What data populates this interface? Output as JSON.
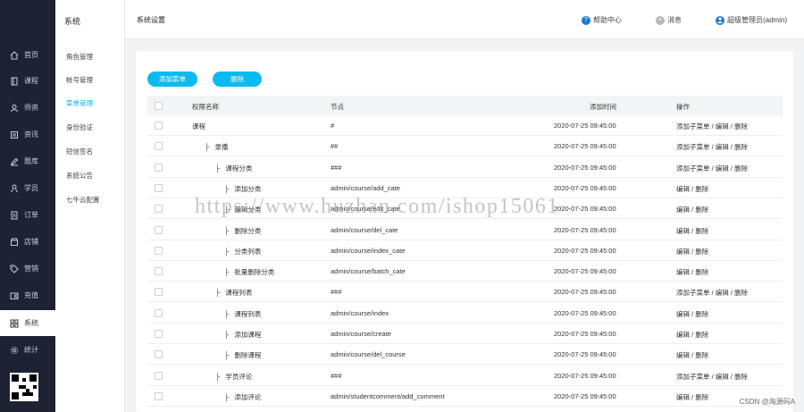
{
  "sidebar": {
    "items": [
      {
        "label": "首页",
        "icon": "home-icon"
      },
      {
        "label": "课程",
        "icon": "book-icon"
      },
      {
        "label": "师资",
        "icon": "teacher-icon"
      },
      {
        "label": "资讯",
        "icon": "news-icon"
      },
      {
        "label": "题库",
        "icon": "edit-icon"
      },
      {
        "label": "学员",
        "icon": "user-icon"
      },
      {
        "label": "订单",
        "icon": "order-icon"
      },
      {
        "label": "店铺",
        "icon": "store-icon"
      },
      {
        "label": "营销",
        "icon": "tag-icon"
      },
      {
        "label": "充值",
        "icon": "wallet-icon"
      },
      {
        "label": "系统",
        "icon": "grid-icon"
      },
      {
        "label": "统计",
        "icon": "gear-icon"
      }
    ],
    "active_index": 10
  },
  "subnav": {
    "title": "系统",
    "items": [
      "角色管理",
      "帐号管理",
      "菜单管理",
      "身份验证",
      "短信签名",
      "系统公告",
      "七牛云配置"
    ],
    "active_index": 2
  },
  "header": {
    "page_title": "系统设置",
    "help": "帮助中心",
    "messages": "消息",
    "user": "超级管理员(admin)"
  },
  "toolbar": {
    "add_menu": "添加菜单",
    "delete": "删除"
  },
  "table": {
    "columns": [
      "权限名称",
      "节点",
      "添加时间",
      "操作"
    ],
    "rows": [
      {
        "name": "课程",
        "level": 0,
        "node": "#",
        "time": "2020-07-25 09:45:00",
        "actions": "添加子菜单 / 编辑 / 删除"
      },
      {
        "name": "录播",
        "level": 1,
        "node": "##",
        "time": "2020-07-25 09:45:00",
        "actions": "添加子菜单 / 编辑 / 删除"
      },
      {
        "name": "课程分类",
        "level": 2,
        "node": "###",
        "time": "2020-07-25 09:45:00",
        "actions": "添加子菜单 / 编辑 / 删除"
      },
      {
        "name": "添加分类",
        "level": 3,
        "node": "admin/course/add_cate",
        "time": "2020-07-25 09:45:00",
        "actions": "编辑 / 删除"
      },
      {
        "name": "编辑分类",
        "level": 3,
        "node": "admin/course/edit_cate",
        "time": "2020-07-25 09:45:00",
        "actions": "编辑 / 删除"
      },
      {
        "name": "删除分类",
        "level": 3,
        "node": "admin/course/del_cate",
        "time": "2020-07-25 09:45:00",
        "actions": "编辑 / 删除"
      },
      {
        "name": "分类列表",
        "level": 3,
        "node": "admin/course/index_cate",
        "time": "2020-07-25 09:45:00",
        "actions": "编辑 / 删除"
      },
      {
        "name": "批量删除分类",
        "level": 3,
        "node": "admin/course/batch_cate",
        "time": "2020-07-25 09:45:00",
        "actions": "编辑 / 删除"
      },
      {
        "name": "课程列表",
        "level": 2,
        "node": "###",
        "time": "2020-07-25 09:45:00",
        "actions": "添加子菜单 / 编辑 / 删除"
      },
      {
        "name": "课程列表",
        "level": 3,
        "node": "admin/course/index",
        "time": "2020-07-25 09:45:00",
        "actions": "编辑 / 删除"
      },
      {
        "name": "添加课程",
        "level": 3,
        "node": "admin/course/create",
        "time": "2020-07-25 09:45:00",
        "actions": "编辑 / 删除"
      },
      {
        "name": "删除课程",
        "level": 3,
        "node": "admin/course/del_course",
        "time": "2020-07-25 09:45:00",
        "actions": "编辑 / 删除"
      },
      {
        "name": "学员评论",
        "level": 2,
        "node": "###",
        "time": "2020-07-25 09:45:00",
        "actions": "添加子菜单 / 编辑 / 删除"
      },
      {
        "name": "添加评论",
        "level": 3,
        "node": "admin/studentcomment/add_comment",
        "time": "2020-07-25 09:45:00",
        "actions": "编辑 / 删除"
      }
    ]
  },
  "watermark": "https://www.huzhan.com/ishop15061",
  "credit": "CSDN @淘源码A",
  "colors": {
    "sidebar_bg": "#1f2233",
    "accent": "#0cbaf0"
  }
}
